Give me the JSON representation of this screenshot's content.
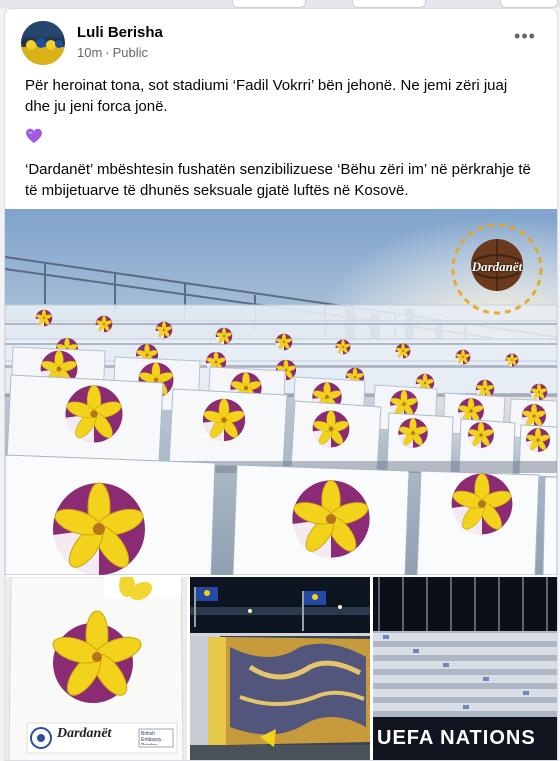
{
  "post": {
    "author": "Luli Berisha",
    "time": "10m",
    "audience": "Public",
    "more_label": "•••",
    "paragraph1": "Për heroinat tona, sot stadiumi ‘Fadil Vokrri’ bën jehonë. Ne jemi zëri juaj dhe ju jeni forca jonë.",
    "heart": "purple-heart-emoji",
    "paragraph2": "‘Dardanët’ mbështesin fushatën senzibilizuese ‘Bëhu zëri im’ në përkrahje të të mbijetuarve të dhunës seksuale gjatë luftës në Kosovë."
  },
  "photos": {
    "main_logo_text": "Dardanët",
    "bag_brand_text": "Dardanët",
    "bag_partner_text": "British Embassy Pristina",
    "banner_text": "UEFA NATIONS"
  },
  "colors": {
    "flower_yellow": "#f2d21b",
    "flower_purple": "#8b2b74",
    "heart": "#a05be0",
    "kosovo_blue": "#244aa5"
  }
}
